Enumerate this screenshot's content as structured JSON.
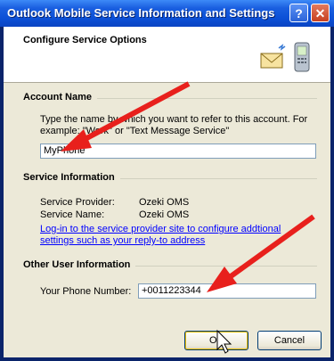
{
  "window": {
    "title": "Outlook Mobile Service Information and Settings",
    "help_label": "?",
    "close_label": "✕"
  },
  "header": {
    "title": "Configure Service Options",
    "icon": "mail-phone-icon"
  },
  "account": {
    "section_title": "Account Name",
    "description_line1": "Type the name by which you want to refer to this account. For",
    "description_line2": "example: \"Work\" or \"Text Message Service\"",
    "value": "MyPhone"
  },
  "service": {
    "section_title": "Service Information",
    "provider_label": "Service Provider:",
    "provider_value": "Ozeki OMS",
    "name_label": "Service Name:",
    "name_value": "Ozeki OMS",
    "link_line1": "Log-in to the service provider site to configure addtional",
    "link_line2": "settings such as your reply-to address"
  },
  "user": {
    "section_title": "Other User Information",
    "phone_label": "Your Phone Number:",
    "phone_value": "+0011223344"
  },
  "buttons": {
    "ok": "OK",
    "cancel": "Cancel"
  },
  "colors": {
    "arrow": "#e8201c",
    "title_bar": "#0b4fd6",
    "link": "#0000ff"
  }
}
